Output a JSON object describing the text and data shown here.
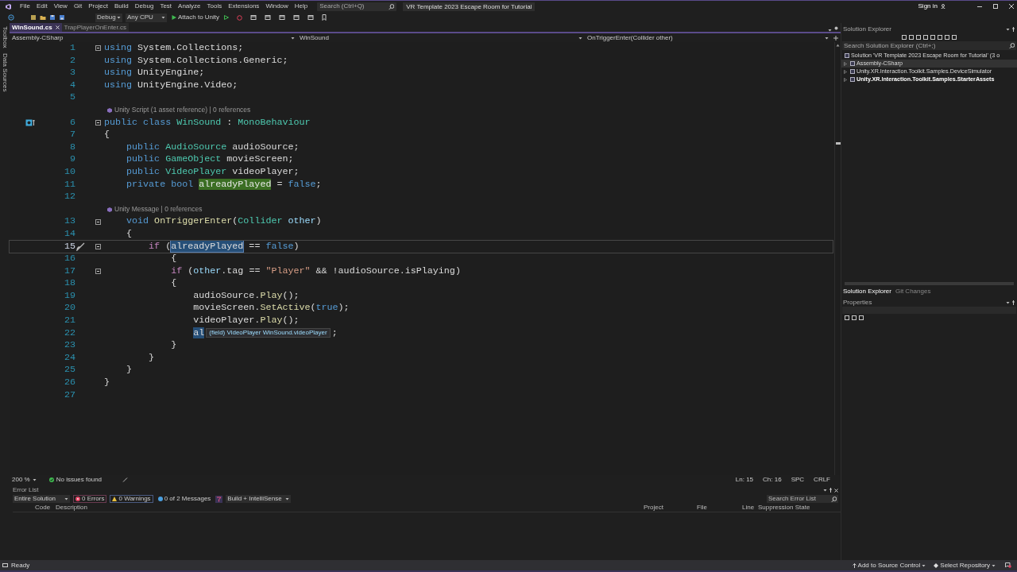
{
  "title_bar": {
    "menu": [
      "File",
      "Edit",
      "View",
      "Git",
      "Project",
      "Build",
      "Debug",
      "Test",
      "Analyze",
      "Tools",
      "Extensions",
      "Window",
      "Help"
    ],
    "search": {
      "placeholder": "Search (Ctrl+Q)"
    },
    "solution_name": "VR Template 2023 Escape Room for Tutorial",
    "sign_in": "Sign in"
  },
  "toolbar": {
    "configuration": "Debug",
    "platform": "Any CPU",
    "run_target": "Attach to Unity"
  },
  "side_tabs": [
    "Toolbox",
    "Data Sources"
  ],
  "document_tabs": [
    {
      "label": "WinSound.cs",
      "selected": true
    },
    {
      "label": "TrapPlayerOnEnter.cs",
      "selected": false
    }
  ],
  "navigation_bar": {
    "project": "Assembly-CSharp",
    "type": "WinSound",
    "member": "OnTriggerEnter(Collider other)"
  },
  "editor": {
    "lines": [
      {
        "kind": "code",
        "number": "1",
        "fold": true,
        "current": false,
        "tokens": [
          {
            "kind": "kw",
            "text": "using"
          },
          {
            "kind": "plain",
            "text": " System.Collections;"
          }
        ]
      },
      {
        "kind": "code",
        "number": "2",
        "fold": false,
        "current": false,
        "tokens": [
          {
            "kind": "kw",
            "text": "using"
          },
          {
            "kind": "plain",
            "text": " System.Collections.Generic;"
          }
        ]
      },
      {
        "kind": "code",
        "number": "3",
        "fold": false,
        "current": false,
        "tokens": [
          {
            "kind": "kw",
            "text": "using"
          },
          {
            "kind": "plain",
            "text": " UnityEngine;"
          }
        ]
      },
      {
        "kind": "code",
        "number": "4",
        "fold": false,
        "current": false,
        "tokens": [
          {
            "kind": "kw",
            "text": "using"
          },
          {
            "kind": "plain",
            "text": " UnityEngine.Video;"
          }
        ]
      },
      {
        "kind": "code",
        "number": "5",
        "fold": false,
        "current": false
      },
      {
        "kind": "lens",
        "text": "Unity Script (1 asset reference) | 0 references"
      },
      {
        "kind": "code",
        "number": "6",
        "fold": true,
        "current": false,
        "marker": {
          "kind": "unity"
        },
        "tokens": [
          {
            "kind": "kw",
            "text": "public class"
          },
          {
            "kind": "type",
            "text": " WinSound"
          },
          {
            "kind": "plain",
            "text": " : "
          },
          {
            "kind": "type",
            "text": "MonoBehaviour"
          }
        ]
      },
      {
        "kind": "code",
        "number": "7",
        "fold": false,
        "current": false,
        "tokens": [
          {
            "kind": "plain",
            "text": "{"
          }
        ]
      },
      {
        "kind": "code",
        "number": "8",
        "fold": false,
        "current": false,
        "tokens": [
          {
            "kind": "kw",
            "text": "    public"
          },
          {
            "kind": "type",
            "text": " AudioSource"
          },
          {
            "kind": "plain",
            "text": " audioSource;"
          }
        ]
      },
      {
        "kind": "code",
        "number": "9",
        "fold": false,
        "current": false,
        "tokens": [
          {
            "kind": "kw",
            "text": "    public"
          },
          {
            "kind": "type",
            "text": " GameObject"
          },
          {
            "kind": "plain",
            "text": " movieScreen;"
          }
        ]
      },
      {
        "kind": "code",
        "number": "10",
        "fold": false,
        "current": false,
        "tokens": [
          {
            "kind": "kw",
            "text": "    public"
          },
          {
            "kind": "type",
            "text": " VideoPlayer"
          },
          {
            "kind": "plain",
            "text": " videoPlayer;"
          }
        ]
      },
      {
        "kind": "code",
        "number": "11",
        "fold": false,
        "current": false,
        "tokens": [
          {
            "kind": "kw",
            "text": "    private bool "
          },
          {
            "kind": "ref",
            "text": "alreadyPlayed"
          },
          {
            "kind": "plain",
            "text": " = "
          },
          {
            "kind": "kw",
            "text": "false"
          },
          {
            "kind": "plain",
            "text": ";"
          }
        ]
      },
      {
        "kind": "code",
        "number": "12",
        "fold": false,
        "current": false
      },
      {
        "kind": "lens",
        "text": "Unity Message | 0 references"
      },
      {
        "kind": "code",
        "number": "13",
        "fold": true,
        "current": false,
        "tokens": [
          {
            "kind": "kw",
            "text": "    void"
          },
          {
            "kind": "method",
            "text": " OnTriggerEnter"
          },
          {
            "kind": "plain",
            "text": "("
          },
          {
            "kind": "type",
            "text": "Collider"
          },
          {
            "kind": "param",
            "text": " other"
          },
          {
            "kind": "plain",
            "text": ")"
          }
        ]
      },
      {
        "kind": "code",
        "number": "14",
        "fold": false,
        "current": false,
        "tokens": [
          {
            "kind": "plain",
            "text": "    {"
          }
        ]
      },
      {
        "kind": "code",
        "number": "15",
        "fold": true,
        "current": true,
        "marker": {
          "kind": "brush"
        },
        "tokens": [
          {
            "kind": "control",
            "text": "        if"
          },
          {
            "kind": "plain",
            "text": " ("
          },
          {
            "kind": "match",
            "text": "alreadyPlayed"
          },
          {
            "kind": "plain",
            "text": " == "
          },
          {
            "kind": "kw",
            "text": "false"
          },
          {
            "kind": "plain",
            "text": ")"
          }
        ]
      },
      {
        "kind": "code",
        "number": "16",
        "fold": false,
        "current": false,
        "tokens": [
          {
            "kind": "plain",
            "text": "            {"
          }
        ]
      },
      {
        "kind": "code",
        "number": "17",
        "fold": true,
        "current": false,
        "tokens": [
          {
            "kind": "control",
            "text": "            if"
          },
          {
            "kind": "plain",
            "text": " ("
          },
          {
            "kind": "param",
            "text": "other"
          },
          {
            "kind": "plain",
            "text": ".tag == "
          },
          {
            "kind": "string",
            "text": "\"Player\""
          },
          {
            "kind": "plain",
            "text": " && !audioSource.isPlaying)"
          }
        ]
      },
      {
        "kind": "code",
        "number": "18",
        "fold": false,
        "current": false,
        "tokens": [
          {
            "kind": "plain",
            "text": "            {"
          }
        ]
      },
      {
        "kind": "code",
        "number": "19",
        "fold": false,
        "current": false,
        "tokens": [
          {
            "kind": "plain",
            "text": "                audioSource."
          },
          {
            "kind": "method",
            "text": "Play"
          },
          {
            "kind": "plain",
            "text": "();"
          }
        ]
      },
      {
        "kind": "code",
        "number": "20",
        "fold": false,
        "current": false,
        "tokens": [
          {
            "kind": "plain",
            "text": "                movieScreen."
          },
          {
            "kind": "method",
            "text": "SetActive"
          },
          {
            "kind": "plain",
            "text": "("
          },
          {
            "kind": "kw",
            "text": "true"
          },
          {
            "kind": "plain",
            "text": ");"
          }
        ]
      },
      {
        "kind": "code",
        "number": "21",
        "fold": false,
        "current": false,
        "tokens": [
          {
            "kind": "plain",
            "text": "                videoPlayer."
          },
          {
            "kind": "method",
            "text": "Play"
          },
          {
            "kind": "plain",
            "text": "();"
          }
        ]
      },
      {
        "kind": "code",
        "number": "22",
        "fold": false,
        "current": false,
        "tokens": [
          {
            "kind": "selection",
            "text": "                al"
          }
        ],
        "tooltip": "(field) VideoPlayer WinSound.videoPlayer",
        "after": ";"
      },
      {
        "kind": "code",
        "number": "23",
        "fold": false,
        "current": false,
        "tokens": [
          {
            "kind": "plain",
            "text": "            }"
          }
        ]
      },
      {
        "kind": "code",
        "number": "24",
        "fold": false,
        "current": false,
        "tokens": [
          {
            "kind": "plain",
            "text": "        }"
          }
        ]
      },
      {
        "kind": "code",
        "number": "25",
        "fold": false,
        "current": false,
        "tokens": [
          {
            "kind": "plain",
            "text": "    }"
          }
        ]
      },
      {
        "kind": "code",
        "number": "26",
        "fold": false,
        "current": false,
        "tokens": [
          {
            "kind": "plain",
            "text": "}"
          }
        ]
      },
      {
        "kind": "code",
        "number": "27",
        "fold": false,
        "current": false
      }
    ]
  },
  "editor_status": {
    "zoom": "200 %",
    "issues": "No issues found",
    "line": "Ln: 15",
    "column": "Ch: 16",
    "whitespace": "SPC",
    "line_endings": "CRLF"
  },
  "error_list": {
    "title": "Error List",
    "scope": "Entire Solution",
    "errors": "0 Errors",
    "warnings": "0 Warnings",
    "messages": "0 of 2 Messages",
    "source": "Build + IntelliSense",
    "search": {
      "placeholder": "Search Error List"
    },
    "columns": [
      "Code",
      "Description",
      "Project",
      "File",
      "Line",
      "Suppression State"
    ]
  },
  "solution_explorer": {
    "title": "Solution Explorer",
    "search": {
      "placeholder": "Search Solution Explorer (Ctrl+;)"
    },
    "tree": [
      {
        "label": "Solution 'VR Template 2023 Escape Room for Tutorial' (3 o",
        "bold": false,
        "selected": false,
        "children": [
          {
            "label": "Assembly-CSharp",
            "bold": false,
            "selected": true
          },
          {
            "label": "Unity.XR.Interaction.Toolkit.Samples.DeviceSimulator",
            "bold": false,
            "selected": false
          },
          {
            "label": "Unity.XR.Interaction.Toolkit.Samples.StarterAssets",
            "bold": true,
            "selected": false
          }
        ]
      }
    ],
    "tabs": [
      {
        "label": "Solution Explorer",
        "selected": true
      },
      {
        "label": "Git Changes",
        "selected": false
      }
    ]
  },
  "properties": {
    "title": "Properties"
  },
  "status_bar": {
    "state": "Ready",
    "source_control": "Add to Source Control",
    "repository": "Select Repository"
  }
}
